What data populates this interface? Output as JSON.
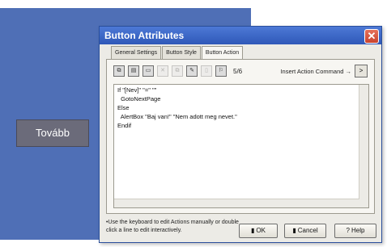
{
  "background": {
    "continue_button_label": "Tovább"
  },
  "dialog": {
    "title": "Button Attributes",
    "close_glyph": "✕",
    "tabs": [
      {
        "label": "General Settings"
      },
      {
        "label": "Button Style"
      },
      {
        "label": "Button Action"
      }
    ],
    "toolbar": {
      "item_count": "5/6",
      "insert_command_label": "Insert Action Command →",
      "insert_button_glyph": ">"
    },
    "script_lines": [
      "If \"[Nev]\" \"=\" \"\"",
      "  GotoNextPage",
      "Else",
      "  AlertBox \"Baj van!\" \"Nem adott meg nevet.\"",
      "Endif"
    ],
    "hint_text": "•Use the keyboard to edit Actions manually or double click a line to edit interactively.",
    "buttons": {
      "ok": "OK",
      "cancel": "Cancel",
      "help": "Help"
    }
  }
}
